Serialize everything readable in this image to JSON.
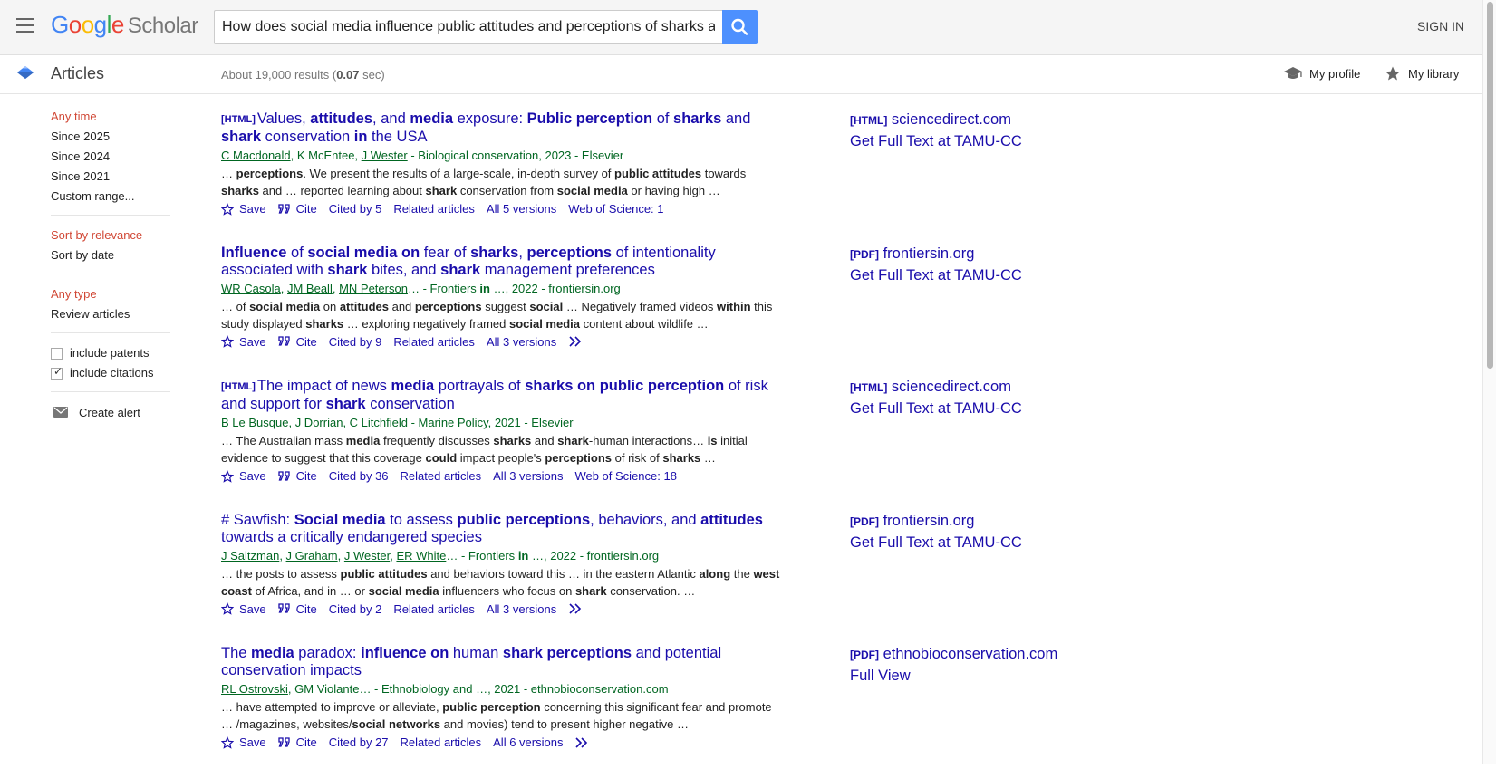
{
  "header": {
    "logo": "Google",
    "logo_sub": "Scholar",
    "search_value": "How does social media influence public attitudes and perceptions of sharks a",
    "sign_in": "SIGN IN"
  },
  "subheader": {
    "section": "Articles",
    "stats_pre": "About 19,000 results (",
    "stats_time": "0.07",
    "stats_post": " sec)",
    "my_profile": "My profile",
    "my_library": "My library"
  },
  "sidebar": {
    "time": [
      "Any time",
      "Since 2025",
      "Since 2024",
      "Since 2021",
      "Custom range..."
    ],
    "sort": [
      "Sort by relevance",
      "Sort by date"
    ],
    "type": [
      "Any type",
      "Review articles"
    ],
    "include_patents": "include patents",
    "include_citations": "include citations",
    "create_alert": "Create alert"
  },
  "actions": {
    "save": "Save",
    "cite": "Cite",
    "related": "Related articles"
  },
  "results": [
    {
      "tag": "[HTML]",
      "title": [
        [
          "Values, ",
          0
        ],
        [
          "attitudes",
          1
        ],
        [
          ", and ",
          0
        ],
        [
          "media",
          1
        ],
        [
          " exposure: ",
          0
        ],
        [
          "Public perception",
          1
        ],
        [
          " of ",
          0
        ],
        [
          "sharks",
          1
        ],
        [
          " and ",
          0
        ],
        [
          "shark",
          1
        ],
        [
          " conservation ",
          0
        ],
        [
          "in",
          1
        ],
        [
          " the USA",
          0
        ]
      ],
      "authors": [
        "C Macdonald",
        "K McEntee",
        "J Wester"
      ],
      "meta": [
        [
          "C Macdonald",
          1
        ],
        [
          ", K McEntee, ",
          0
        ],
        [
          "J Wester",
          1
        ],
        [
          " - Biological conservation, 2023 - Elsevier",
          0
        ]
      ],
      "snippet": [
        [
          "… ",
          0
        ],
        [
          "perceptions",
          1
        ],
        [
          ". We present the results of a large-scale, in-depth survey of ",
          0
        ],
        [
          "public attitudes",
          1
        ],
        [
          " towards ",
          0
        ],
        [
          "sharks",
          1
        ],
        [
          " and … reported learning about ",
          0
        ],
        [
          "shark",
          1
        ],
        [
          " conservation from ",
          0
        ],
        [
          "social media",
          1
        ],
        [
          " or having high …",
          0
        ]
      ],
      "cited": "Cited by 5",
      "versions": "All 5 versions",
      "extra": "Web of Science: 1",
      "link_tag": "[HTML]",
      "link_domain": "sciencedirect.com",
      "link_fulltext": "Get Full Text at TAMU-CC"
    },
    {
      "tag": "",
      "title": [
        [
          "Influence",
          1
        ],
        [
          " of ",
          0
        ],
        [
          "social media on",
          1
        ],
        [
          " fear of ",
          0
        ],
        [
          "sharks",
          1
        ],
        [
          ", ",
          0
        ],
        [
          "perceptions",
          1
        ],
        [
          " of intentionality associated with ",
          0
        ],
        [
          "shark",
          1
        ],
        [
          " bites, and ",
          0
        ],
        [
          "shark",
          1
        ],
        [
          " management preferences",
          0
        ]
      ],
      "meta": [
        [
          "WR Casola",
          1
        ],
        [
          ", ",
          0
        ],
        [
          "JM Beall",
          1
        ],
        [
          ", ",
          0
        ],
        [
          "MN Peterson",
          1
        ],
        [
          "… - Frontiers ",
          0
        ],
        [
          "in",
          2
        ],
        [
          " …, 2022 - frontiersin.org",
          0
        ]
      ],
      "snippet": [
        [
          "… of ",
          0
        ],
        [
          "social media",
          1
        ],
        [
          " on ",
          0
        ],
        [
          "attitudes",
          1
        ],
        [
          " and ",
          0
        ],
        [
          "perceptions",
          1
        ],
        [
          " suggest ",
          0
        ],
        [
          "social",
          1
        ],
        [
          " … Negatively framed videos ",
          0
        ],
        [
          "within",
          1
        ],
        [
          " this study displayed ",
          0
        ],
        [
          "sharks",
          1
        ],
        [
          " … exploring negatively framed ",
          0
        ],
        [
          "social media",
          1
        ],
        [
          " content about wildlife …",
          0
        ]
      ],
      "cited": "Cited by 9",
      "versions": "All 3 versions",
      "extra": "",
      "link_tag": "[PDF]",
      "link_domain": "frontiersin.org",
      "link_fulltext": "Get Full Text at TAMU-CC"
    },
    {
      "tag": "[HTML]",
      "title": [
        [
          "The impact of news ",
          0
        ],
        [
          "media",
          1
        ],
        [
          " portrayals of ",
          0
        ],
        [
          "sharks on public perception",
          1
        ],
        [
          " of risk and support for ",
          0
        ],
        [
          "shark",
          1
        ],
        [
          " conservation",
          0
        ]
      ],
      "meta": [
        [
          "B Le Busque",
          1
        ],
        [
          ", ",
          0
        ],
        [
          "J Dorrian",
          1
        ],
        [
          ", ",
          0
        ],
        [
          "C Litchfield",
          1
        ],
        [
          " - Marine Policy, 2021 - Elsevier",
          0
        ]
      ],
      "snippet": [
        [
          "… The Australian mass ",
          0
        ],
        [
          "media",
          1
        ],
        [
          " frequently discusses ",
          0
        ],
        [
          "sharks",
          1
        ],
        [
          " and ",
          0
        ],
        [
          "shark",
          1
        ],
        [
          "-human interactions… ",
          0
        ],
        [
          "is",
          1
        ],
        [
          " initial evidence to suggest that this coverage ",
          0
        ],
        [
          "could",
          1
        ],
        [
          " impact people's ",
          0
        ],
        [
          "perceptions",
          1
        ],
        [
          " of risk of ",
          0
        ],
        [
          "sharks",
          1
        ],
        [
          " …",
          0
        ]
      ],
      "cited": "Cited by 36",
      "versions": "All 3 versions",
      "extra": "Web of Science: 18",
      "link_tag": "[HTML]",
      "link_domain": "sciencedirect.com",
      "link_fulltext": "Get Full Text at TAMU-CC"
    },
    {
      "tag": "",
      "title": [
        [
          "# Sawfish: ",
          0
        ],
        [
          "Social media",
          1
        ],
        [
          " to assess ",
          0
        ],
        [
          "public perceptions",
          1
        ],
        [
          ", behaviors, and ",
          0
        ],
        [
          "attitudes",
          1
        ],
        [
          " towards a critically endangered species",
          0
        ]
      ],
      "meta": [
        [
          "J Saltzman",
          1
        ],
        [
          ", ",
          0
        ],
        [
          "J Graham",
          1
        ],
        [
          ", ",
          0
        ],
        [
          "J Wester",
          1
        ],
        [
          ", ",
          0
        ],
        [
          "ER White",
          1
        ],
        [
          "… - Frontiers ",
          0
        ],
        [
          "in",
          2
        ],
        [
          " …, 2022 - frontiersin.org",
          0
        ]
      ],
      "snippet": [
        [
          "… the posts to assess ",
          0
        ],
        [
          "public attitudes",
          1
        ],
        [
          " and behaviors toward this … in the eastern Atlantic ",
          0
        ],
        [
          "along",
          1
        ],
        [
          " the ",
          0
        ],
        [
          "west coast",
          1
        ],
        [
          " of Africa, and in … or ",
          0
        ],
        [
          "social media",
          1
        ],
        [
          " influencers who focus on ",
          0
        ],
        [
          "shark",
          1
        ],
        [
          " conservation. …",
          0
        ]
      ],
      "cited": "Cited by 2",
      "versions": "All 3 versions",
      "extra": "",
      "link_tag": "[PDF]",
      "link_domain": "frontiersin.org",
      "link_fulltext": "Get Full Text at TAMU-CC"
    },
    {
      "tag": "",
      "title": [
        [
          "The ",
          0
        ],
        [
          "media",
          1
        ],
        [
          " paradox: ",
          0
        ],
        [
          "influence on",
          1
        ],
        [
          " human ",
          0
        ],
        [
          "shark perceptions",
          1
        ],
        [
          " and potential conservation impacts",
          0
        ]
      ],
      "meta": [
        [
          "RL Ostrovski",
          1
        ],
        [
          ", GM Violante… - Ethnobiology and …, 2021 - ethnobioconservation.com",
          0
        ]
      ],
      "snippet": [
        [
          "… have attempted to improve or alleviate, ",
          0
        ],
        [
          "public perception",
          1
        ],
        [
          " concerning this significant fear and promote … /magazines, websites/",
          0
        ],
        [
          "social networks",
          1
        ],
        [
          " and movies) tend to present higher negative …",
          0
        ]
      ],
      "cited": "Cited by 27",
      "versions": "All 6 versions",
      "extra": "",
      "link_tag": "[PDF]",
      "link_domain": "ethnobioconservation.com",
      "link_fulltext": "Full View"
    }
  ]
}
